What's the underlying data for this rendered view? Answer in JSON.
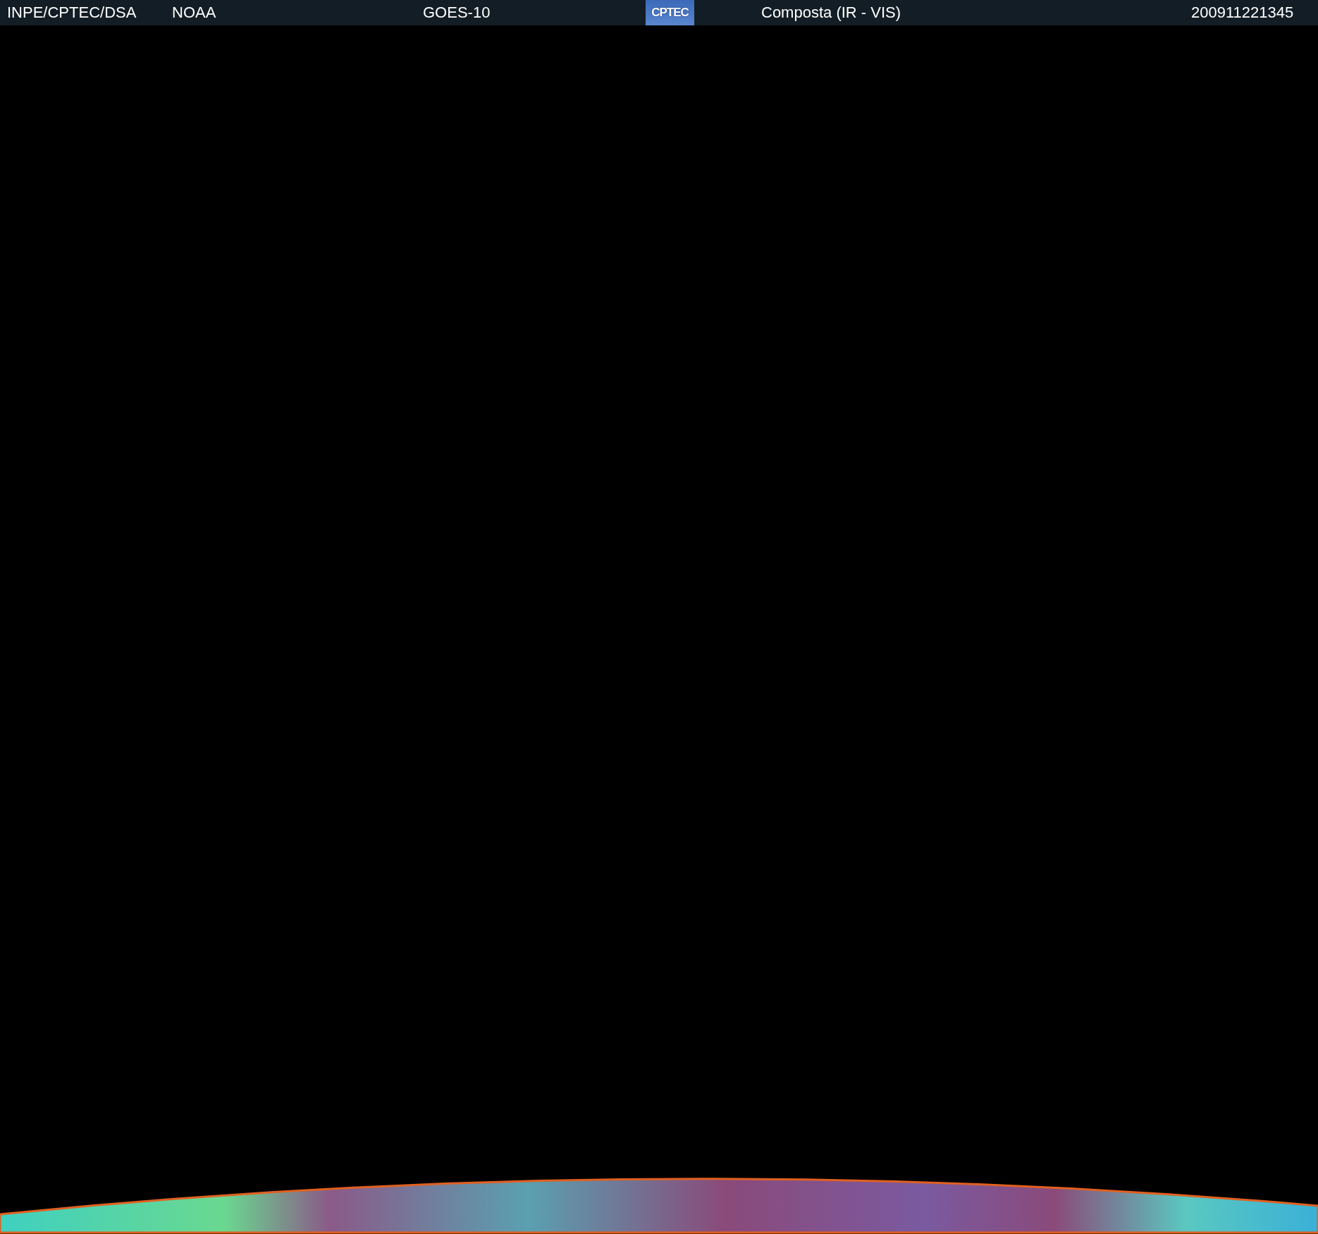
{
  "header": {
    "items": [
      {
        "kind": "text",
        "text": "INPE/CPTEC/DSA"
      },
      {
        "kind": "text",
        "text": "NOAA"
      },
      {
        "kind": "text",
        "text": "GOES-10"
      },
      {
        "kind": "logo",
        "text": "CPTEC"
      },
      {
        "kind": "text",
        "text": "Composta (IR - VIS)"
      },
      {
        "kind": "text",
        "text": "200911221345"
      }
    ]
  }
}
